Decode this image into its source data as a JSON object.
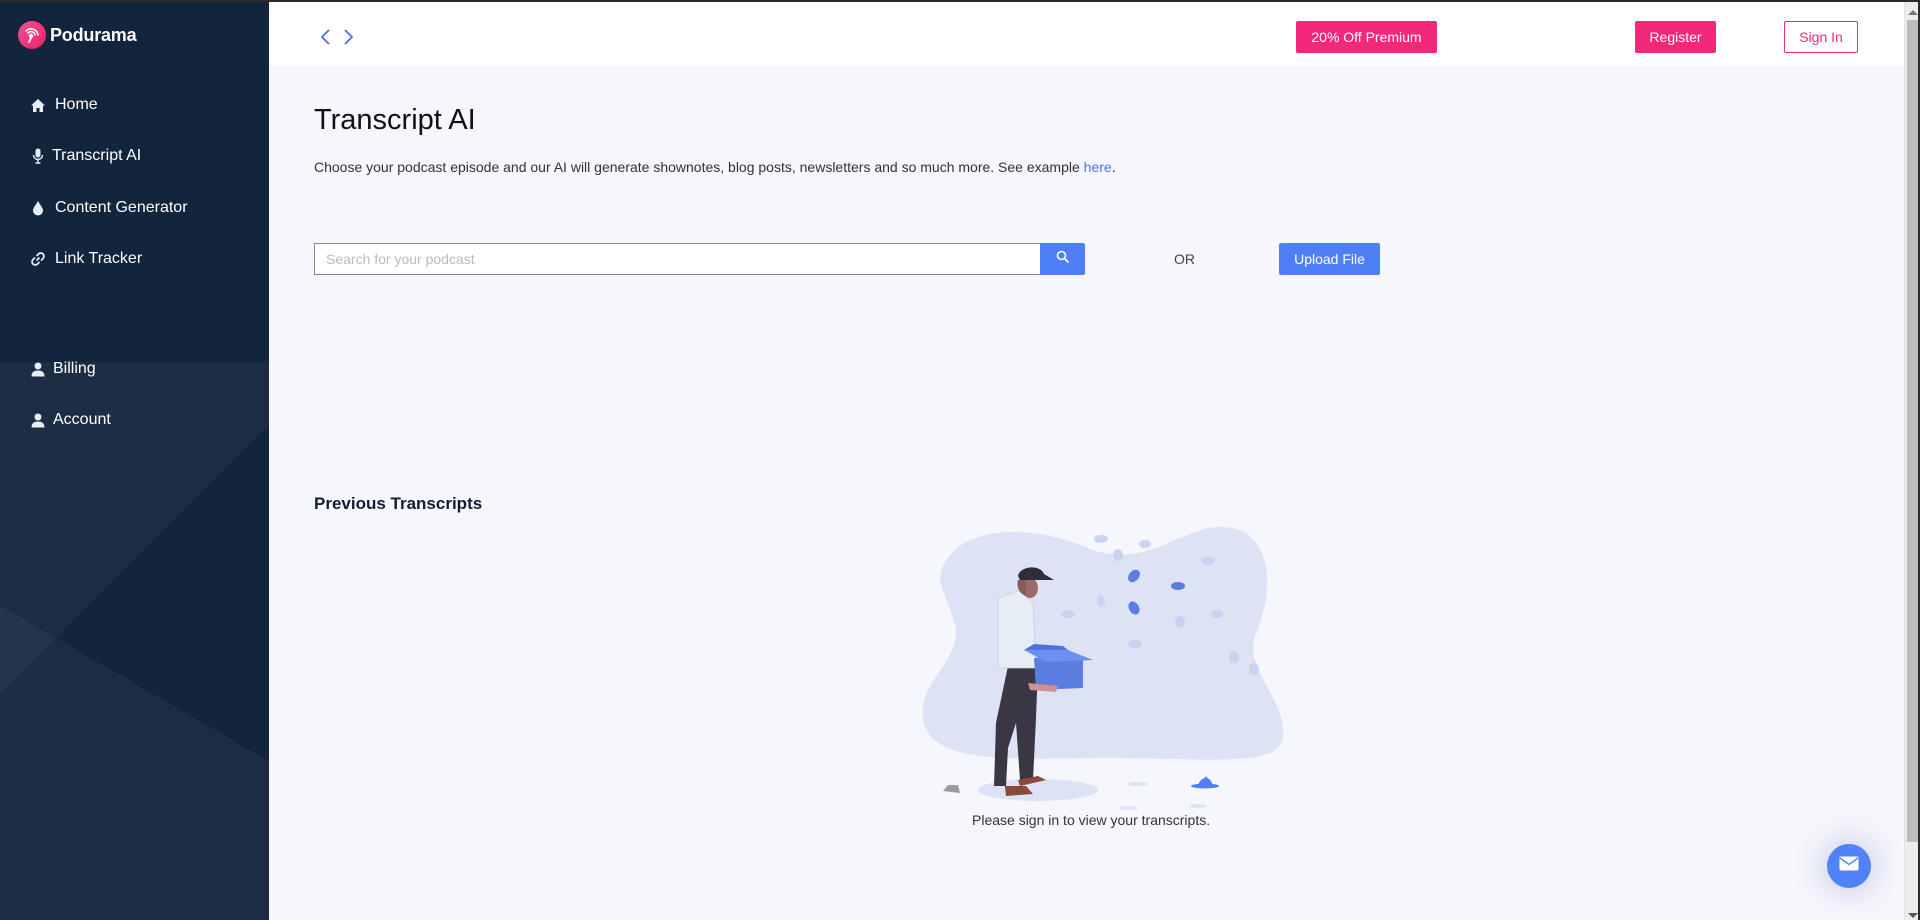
{
  "brand": {
    "name": "Podurama",
    "logo_icon": "podcast-signal-icon",
    "accent_color": "#f2297a"
  },
  "sidebar": {
    "items": [
      {
        "label": "Home",
        "icon": "home-icon"
      },
      {
        "label": "Transcript AI",
        "icon": "microphone-icon"
      },
      {
        "label": "Content Generator",
        "icon": "droplet-icon"
      },
      {
        "label": "Link Tracker",
        "icon": "link-icon"
      },
      {
        "label": "Billing",
        "icon": "user-icon"
      },
      {
        "label": "Account",
        "icon": "user-icon"
      }
    ]
  },
  "topbar": {
    "back_icon": "chevron-left-icon",
    "forward_icon": "chevron-right-icon",
    "promo_label": "20% Off Premium",
    "register_label": "Register",
    "signin_label": "Sign In"
  },
  "main": {
    "title": "Transcript AI",
    "description": "Choose your podcast episode and our AI will generate shownotes, blog posts, newsletters and so much more. See example ",
    "description_link": "here",
    "description_end": ".",
    "search": {
      "placeholder": "Search for your podcast",
      "value": ""
    },
    "or_label": "OR",
    "upload_label": "Upload File",
    "previous_title": "Previous Transcripts",
    "empty_message": "Please sign in to view your transcripts."
  },
  "colors": {
    "primary_blue": "#4f7ff7",
    "sidebar_bg": "#13243d",
    "page_bg": "#f6f7fc"
  }
}
